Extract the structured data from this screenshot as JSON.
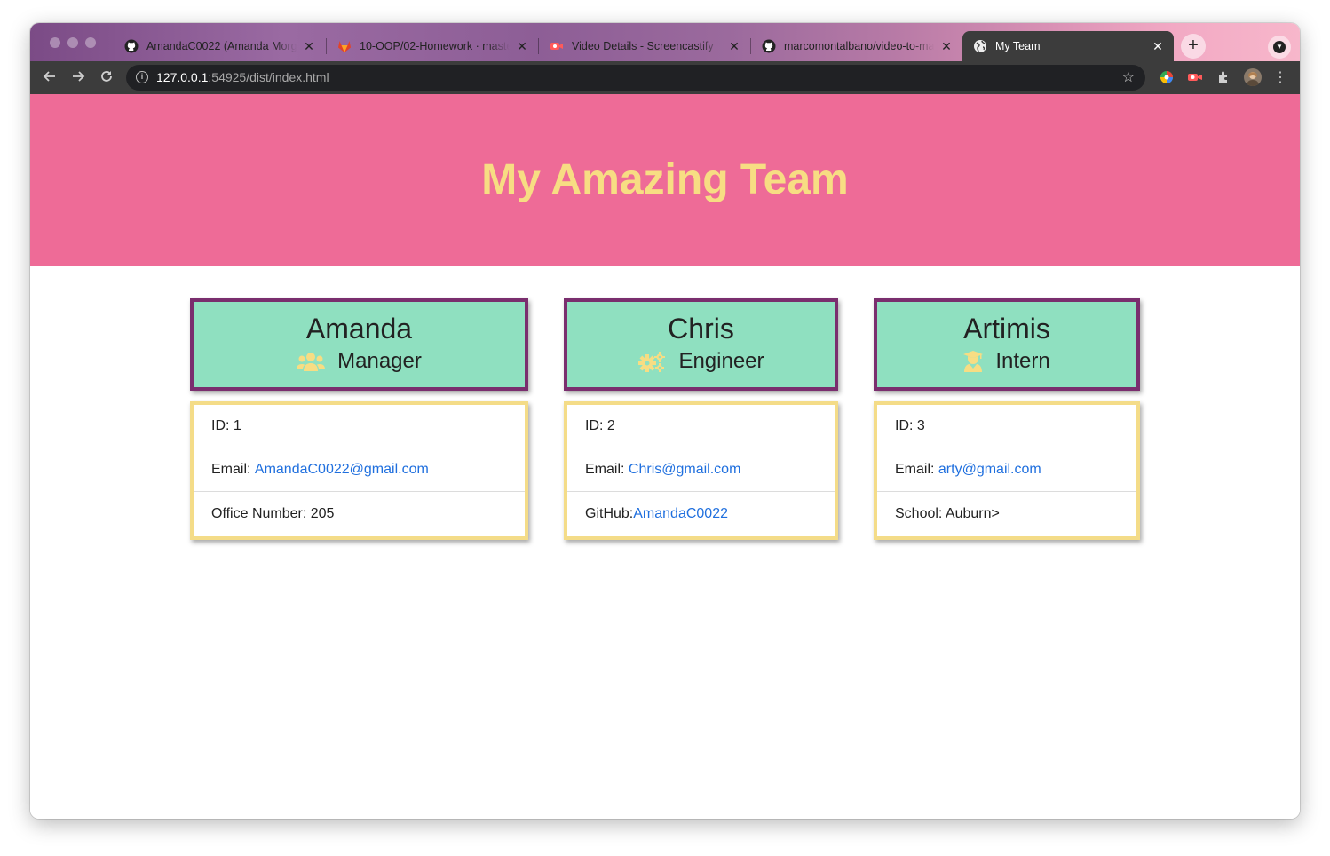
{
  "browser": {
    "tabs": [
      {
        "title": "AmandaC0022 (Amanda Morgan)",
        "icon": "github-icon"
      },
      {
        "title": "10-OOP/02-Homework · master",
        "icon": "gitlab-icon"
      },
      {
        "title": "Video Details - Screencastify",
        "icon": "screencastify-icon"
      },
      {
        "title": "marcomontalbano/video-to-markdown",
        "icon": "github-icon"
      },
      {
        "title": "My Team",
        "icon": "globe-icon",
        "active": true
      }
    ],
    "url_host": "127.0.0.1",
    "url_rest": ":54925/dist/index.html"
  },
  "page": {
    "heading": "My Amazing Team",
    "colors": {
      "jumbotron": "#ee6b97",
      "heading": "#f7dd83",
      "card_head": "#8fe0c0",
      "card_head_border": "#7a2e6e",
      "card_body_border": "#f4dc88",
      "link": "#1f6fde"
    },
    "cards": [
      {
        "name": "Amanda",
        "role": "Manager",
        "role_icon": "users-icon",
        "id_label": "ID: 1",
        "email_label": "Email: ",
        "email": "AmandaC0022@gmail.com",
        "extra_label": "Office Number: 205",
        "extra_link": ""
      },
      {
        "name": "Chris",
        "role": "Engineer",
        "role_icon": "cogs-icon",
        "id_label": "ID: 2",
        "email_label": "Email: ",
        "email": "Chris@gmail.com",
        "extra_label": "GitHub:",
        "extra_link": "AmandaC0022"
      },
      {
        "name": "Artimis",
        "role": "Intern",
        "role_icon": "graduate-icon",
        "id_label": "ID: 3",
        "email_label": "Email: ",
        "email": "arty@gmail.com",
        "extra_label": "School: Auburn>",
        "extra_link": ""
      }
    ]
  }
}
